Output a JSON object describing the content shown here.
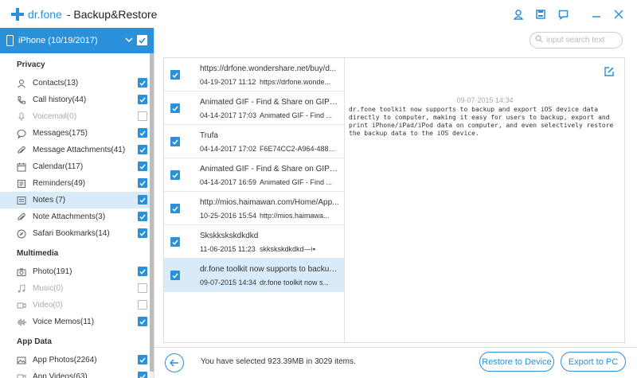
{
  "app": {
    "brand": "dr.fone",
    "title": "- Backup&Restore"
  },
  "titlebar_icons": [
    "user-icon",
    "save-icon",
    "feedback-icon",
    "minimize-icon",
    "close-icon"
  ],
  "device": {
    "name": "iPhone (10/19/2017)",
    "checked": true
  },
  "sidebar": {
    "sections": [
      {
        "title": "Privacy",
        "items": [
          {
            "label": "Contacts(13)",
            "icon": "contacts-icon",
            "checked": true
          },
          {
            "label": "Call history(44)",
            "icon": "phone-icon",
            "checked": true
          },
          {
            "label": "Voicemail(0)",
            "icon": "microphone-icon",
            "checked": false,
            "disabled": true
          },
          {
            "label": "Messages(175)",
            "icon": "message-icon",
            "checked": true
          },
          {
            "label": "Message Attachments(41)",
            "icon": "attachment-icon",
            "checked": true
          },
          {
            "label": "Calendar(117)",
            "icon": "calendar-icon",
            "checked": true
          },
          {
            "label": "Reminders(49)",
            "icon": "reminder-icon",
            "checked": true
          },
          {
            "label": "Notes (7)",
            "icon": "notes-icon",
            "checked": true,
            "selected": true
          },
          {
            "label": "Note Attachments(3)",
            "icon": "attachment-icon",
            "checked": true
          },
          {
            "label": "Safari Bookmarks(14)",
            "icon": "compass-icon",
            "checked": true
          }
        ]
      },
      {
        "title": "Multimedia",
        "items": [
          {
            "label": "Photo(191)",
            "icon": "camera-icon",
            "checked": true
          },
          {
            "label": "Music(0)",
            "icon": "music-icon",
            "checked": false,
            "disabled": true
          },
          {
            "label": "Video(0)",
            "icon": "video-icon",
            "checked": false,
            "disabled": true
          },
          {
            "label": "Voice Memos(11)",
            "icon": "voice-memo-icon",
            "checked": true
          }
        ]
      },
      {
        "title": "App Data",
        "items": [
          {
            "label": "App Photos(2264)",
            "icon": "photo-icon",
            "checked": true
          },
          {
            "label": "App Videos(63)",
            "icon": "video-icon",
            "checked": true
          }
        ]
      }
    ]
  },
  "search": {
    "placeholder": "input search text",
    "value": ""
  },
  "notes": [
    {
      "title": "https://drfone.wondershare.net/buy/d...",
      "date": "04-19-2017 11:12",
      "snippet": "https://drfone.wonde...",
      "checked": true
    },
    {
      "title": "Animated GIF - Find & Share on GIPHY",
      "date": "04-14-2017 17:03",
      "snippet": "Animated GIF - Find ...",
      "checked": true
    },
    {
      "title": "Trufa",
      "date": "04-14-2017 17:02",
      "snippet": "F6E74CC2-A964-488E-...",
      "checked": true
    },
    {
      "title": "Animated GIF - Find & Share on GIPHY",
      "date": "04-14-2017 16:59",
      "snippet": "Animated GIF - Find ...",
      "checked": true
    },
    {
      "title": "http://mios.haimawan.com/Home/App...",
      "date": "10-25-2016 15:54",
      "snippet": "http://mios.haimawa...",
      "checked": true
    },
    {
      "title": "Skskkskskdkdkd",
      "date": "11-06-2015 11:23",
      "snippet": "skkskskdkdkd—⟊▪",
      "checked": true
    },
    {
      "title": "dr.fone toolkit now supports to backup...",
      "date": "09-07-2015 14:34",
      "snippet": "dr.fone toolkit now s...",
      "checked": true,
      "selected": true
    }
  ],
  "detail": {
    "date": "09-07-2015 14:34",
    "body": "dr.fone toolkit now supports to backup and export iOS device data directly to computer, making it easy for users to backup, export and print iPhone/iPad/iPod data on computer, and even selectively restore the backup data to the iOS device."
  },
  "footer": {
    "status": "You have selected 923.39MB in 3029 items.",
    "restore_label": "Restore to Device",
    "export_label": "Export to PC"
  },
  "colors": {
    "accent": "#2a90d9",
    "selected_bg": "#d9ebf9"
  }
}
